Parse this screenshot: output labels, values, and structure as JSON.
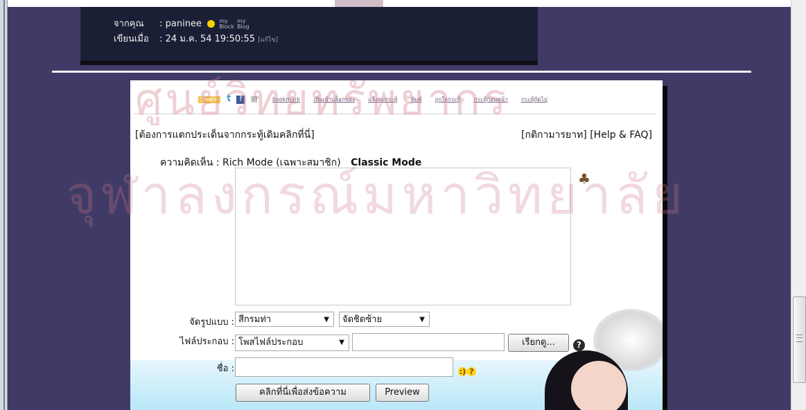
{
  "post": {
    "from_label": "จากคุณ",
    "from_value": ": paninee",
    "badge_top": "my",
    "badge_block": "Block",
    "badge_top2": "my",
    "badge_blog": "Blog",
    "written_label": "เขียนเมื่อ",
    "written_value": ": 24 ม.ค. 54 19:50:55",
    "edit_link": "[แก้ไข]"
  },
  "watermark": {
    "line1": "ศูนย์วิทยทรัพยากร",
    "line2": "จุฬาลงกรณ์มหาวิทยาลัย"
  },
  "share": {
    "share_label": "Share",
    "twitter_icon": "twitter-icon",
    "facebook_icon": "facebook-icon",
    "links": [
      "bookmark",
      "เพิ่มเข้าบล็อกของ",
      "แจ้งลบกระทู้",
      "พิมพ์",
      "ถูกใจกระทู้",
      "กระทู้ก่อนหน้า",
      "กระทู้ถัดไป"
    ]
  },
  "form": {
    "branch_link": "[ต้องการแตกประเด็นจากกระทู้เดิมคลิกที่นี่]",
    "rules_link": "[กติกามารยาท]",
    "help_link": "[Help & FAQ]",
    "comment_label": "ความคิดเห็น :",
    "rich_mode": "Rich Mode (เฉพาะสมาชิก)",
    "classic_mode": "Classic Mode",
    "format_label": "จัดรูปแบบ :",
    "color_select": "สีกรมท่า",
    "align_select": "จัดชิดซ้าย",
    "attach_label": "ไฟล์ประกอบ :",
    "attach_select": "โพสไฟล์ประกอบ",
    "browse_button": "เรียกดู...",
    "name_label": "ชื่อ :",
    "submit_button": "คลิกที่นี่เพื่อส่งข้อความ",
    "preview_button": "Preview"
  },
  "colors": {
    "page_background": "#403b66",
    "post_box": "#1b1f36"
  }
}
